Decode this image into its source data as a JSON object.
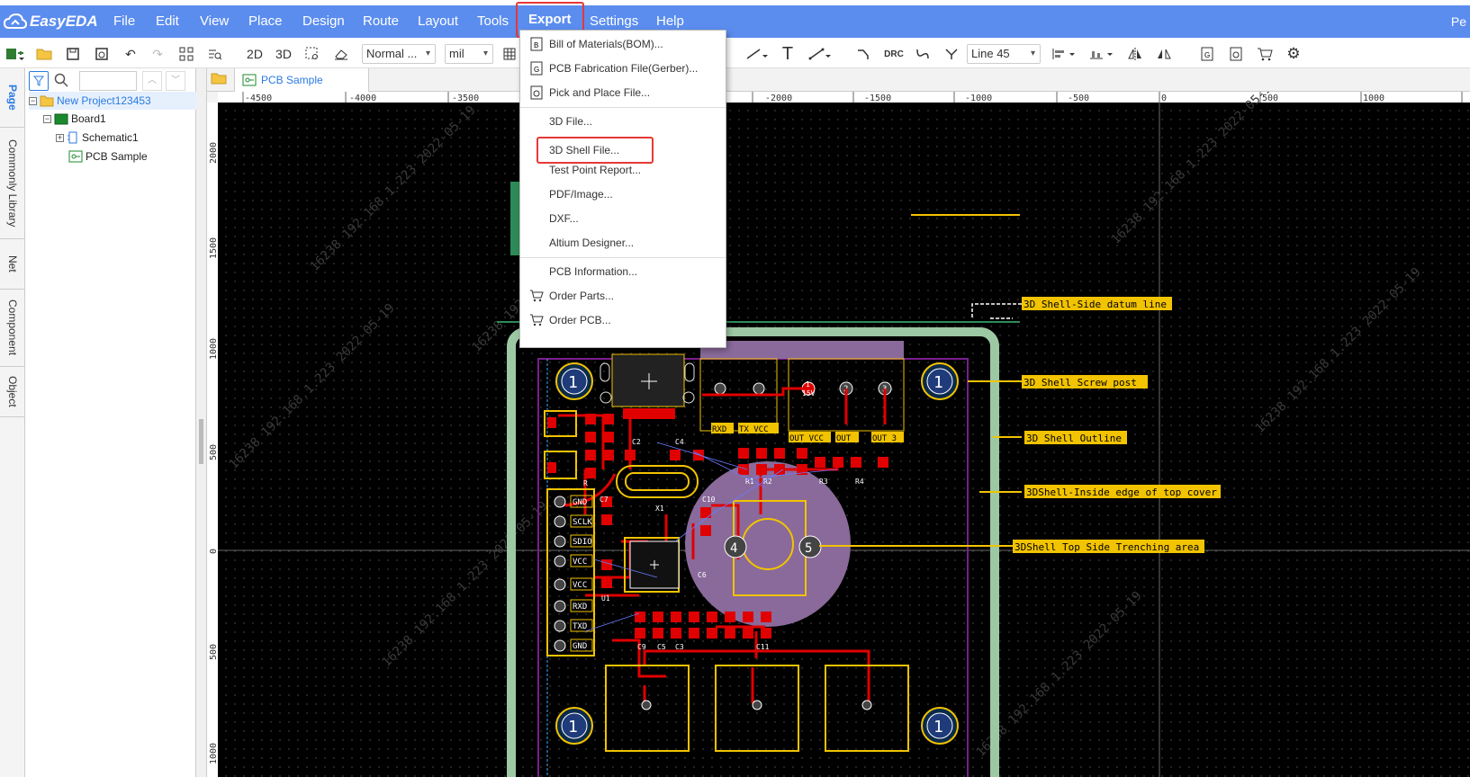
{
  "app": {
    "logo_text": "EasyEDA",
    "user": "Pe"
  },
  "menu": [
    {
      "label": "File"
    },
    {
      "label": "Edit"
    },
    {
      "label": "View"
    },
    {
      "label": "Place"
    },
    {
      "label": "Design"
    },
    {
      "label": "Route"
    },
    {
      "label": "Layout"
    },
    {
      "label": "Tools"
    },
    {
      "label": "Export"
    },
    {
      "label": "Settings"
    },
    {
      "label": "Help"
    }
  ],
  "toolbar": {
    "view_2d": "2D",
    "view_3d": "3D",
    "display_mode": "Normal ...",
    "units": "mil",
    "route_mode": "Line 45",
    "drc": "DRC"
  },
  "side_tabs": [
    "Page",
    "Commonly Library",
    "Net",
    "Component",
    "Object"
  ],
  "tree": {
    "project": "New Project123453",
    "board": "Board1",
    "schematic": "Schematic1",
    "pcb": "PCB Sample"
  },
  "doc_tab": "PCB Sample",
  "export_menu": {
    "items": [
      {
        "label": "Bill of Materials(BOM)...",
        "icon": "bom-icon"
      },
      {
        "label": "PCB Fabrication File(Gerber)...",
        "icon": "gerber-icon"
      },
      {
        "label": "Pick and Place File...",
        "icon": "pick-place-icon"
      },
      {
        "label": "3D File..."
      },
      {
        "label": "3D Shell File..."
      },
      {
        "label": "Test Point Report..."
      },
      {
        "label": "PDF/Image..."
      },
      {
        "label": "DXF..."
      },
      {
        "label": "Altium Designer..."
      },
      {
        "label": "PCB Information..."
      },
      {
        "label": "Order Parts...",
        "icon": "cart-icon"
      },
      {
        "label": "Order PCB...",
        "icon": "cart-icon"
      }
    ]
  },
  "ruler": {
    "top": [
      "-4500",
      "-4000",
      "-3500",
      "-2000",
      "-1500",
      "-1000",
      "-500",
      "0",
      "500",
      "1000"
    ],
    "left": [
      "2000",
      "1500",
      "1000",
      "500",
      "0",
      "500",
      "1000"
    ]
  },
  "annotations": [
    "3D Shell-Side datum line",
    "3D Shell  Screw post",
    "3D Shell Outline",
    "3DShell-Inside edge of top cover",
    "3DShell Top Side Trenching area"
  ],
  "pcb_labels": {
    "header_pins": [
      "GND",
      "SCLK",
      "SDIO",
      "VCC",
      "VCC",
      "RXD",
      "TXD",
      "GND"
    ],
    "screw_post": "1",
    "top_connector": [
      "RXD",
      "TX VCC",
      "OUT VCC",
      "OUT",
      "OUT 3"
    ],
    "pad_numbers": [
      "1",
      "2",
      "3"
    ],
    "pad_voltage": "15V",
    "pot_left": "4",
    "pot_right": "5",
    "parts": [
      "C2",
      "C4",
      "X1",
      "C10",
      "C6",
      "C7",
      "U1",
      "R",
      "R1",
      "R2",
      "R3",
      "R4",
      "C3",
      "C5",
      "C9",
      "C11"
    ],
    "watermark": "16238 192.168.1.223 2022-05-19"
  },
  "colors": {
    "menubar": "#5b8def",
    "highlight": "#e53935",
    "accent": "#2a7ae2",
    "board_bg": "#000000",
    "track": "#e00000",
    "silk": "#f2c300",
    "outline": "#9cc9a3"
  }
}
